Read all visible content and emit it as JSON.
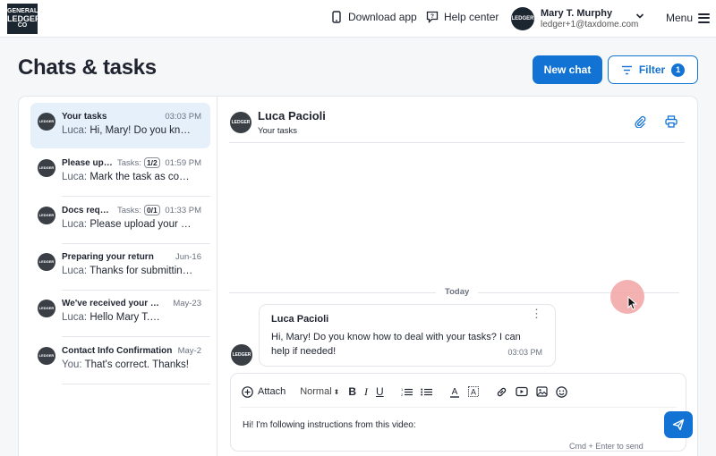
{
  "brand": {
    "logo_line1": "GENERAL",
    "logo_line2": "LEDGER",
    "logo_line3": "CO"
  },
  "topbar": {
    "download_label": "Download app",
    "help_label": "Help center",
    "user_name": "Mary T. Murphy",
    "user_email": "ledger+1@taxdome.com",
    "menu_label": "Menu"
  },
  "page": {
    "title": "Chats & tasks",
    "new_chat_label": "New chat",
    "filter_label": "Filter",
    "filter_count": "1"
  },
  "chats": [
    {
      "title": "Your tasks",
      "time": "03:03 PM",
      "who": "Luca:",
      "preview": "Hi, Mary! Do you know how to deal with your tasks?"
    },
    {
      "title": "Please upload documents",
      "tasks_label": "Tasks:",
      "tasks": "1/2",
      "time": "01:59 PM",
      "who": "Luca:",
      "preview": "Mark the task as completed"
    },
    {
      "title": "Docs required",
      "tasks_label": "Tasks:",
      "tasks": "0/1",
      "time": "01:33 PM",
      "who": "Luca:",
      "preview": "Please upload your documents"
    },
    {
      "title": "Preparing your return",
      "time": "Jun-16",
      "who": "Luca:",
      "preview": "Thanks for submitting the documents"
    },
    {
      "title": "We've received your paid invoice",
      "time": "May-23",
      "who": "Luca:",
      "preview": "Hello Mary T.…"
    },
    {
      "title": "Contact Info Confirmation",
      "time": "May-2",
      "who": "You:",
      "preview": "That's correct. Thanks!"
    }
  ],
  "chat": {
    "name": "Luca Pacioli",
    "subtitle": "Your tasks",
    "date_divider": "Today",
    "message": {
      "from": "Luca Pacioli",
      "text": "Hi, Mary! Do you know how to deal with your tasks? I can help if needed!",
      "time": "03:03 PM"
    }
  },
  "composer": {
    "attach_label": "Attach",
    "style_label": "Normal",
    "draft": "Hi! I'm following instructions from this video:",
    "hint": "Cmd + Enter to send"
  },
  "colors": {
    "accent": "#1273d4",
    "active_item": "#e6f0fb",
    "cursor_highlight": "#f2a3a3"
  }
}
